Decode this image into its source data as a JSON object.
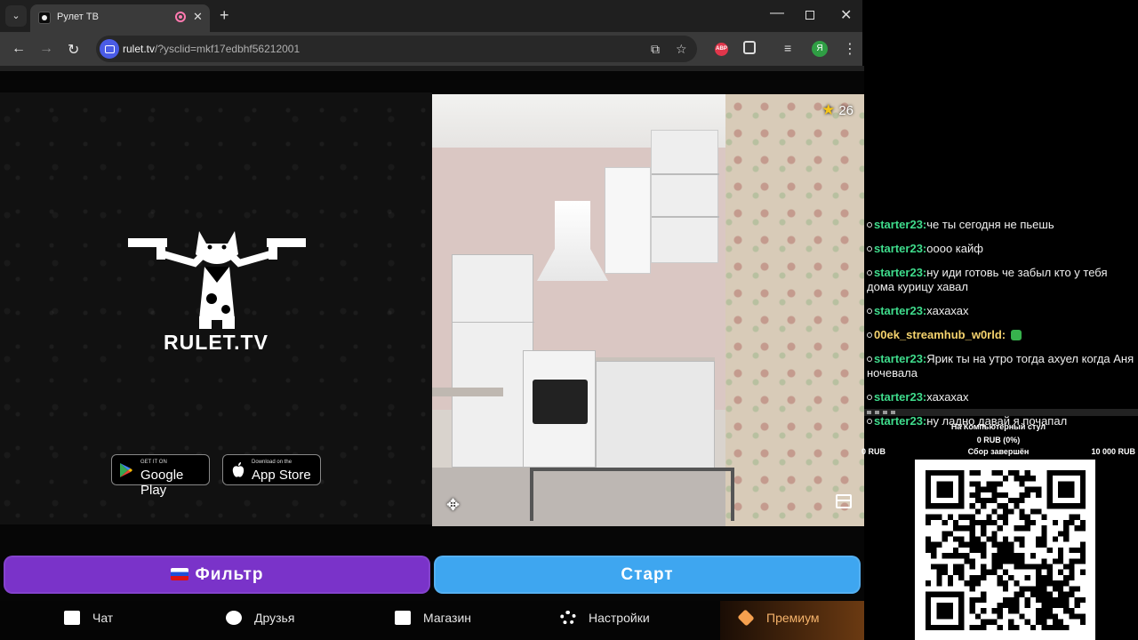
{
  "browser": {
    "tab_title": "Рулет ТВ",
    "tab_close": "✕",
    "new_tab": "+",
    "url_host": "rulet.tv",
    "url_rest": "/?ysclid=mkf17edbhf56212001",
    "back": "←",
    "forward": "→",
    "reload": "↻",
    "menu_chevron": "⌄",
    "window_min": "—",
    "window_close": "✕",
    "install": "⧉",
    "bookmark": "☆",
    "extension_abp": "ABP",
    "media": "≡",
    "profile_initial": "Я",
    "menu": "⋮"
  },
  "left_panel": {
    "logo_text": "RULET.TV",
    "google_play": {
      "small": "GET IT ON",
      "big": "Google Play"
    },
    "app_store": {
      "small": "Download on the",
      "big": "App Store"
    }
  },
  "video": {
    "star_count": "26",
    "star_icon": "★",
    "move_icon": "✥"
  },
  "actions": {
    "filter_label": "Фильтр",
    "start_label": "Старт"
  },
  "bottom_nav": {
    "chat": "Чат",
    "friends": "Друзья",
    "shop": "Магазин",
    "settings": "Настройки",
    "premium": "Премиум"
  },
  "chat": {
    "user_color": "#3fdc8c",
    "alt_user_color": "#f5d36e",
    "messages": [
      {
        "user": "starter23:",
        "text": "че ты сегодня не пьешь"
      },
      {
        "user": "starter23:",
        "text": "оооо кайф"
      },
      {
        "user": "starter23:",
        "text": "ну иди готовь че забыл кто у тебя дома курицу хавал"
      },
      {
        "user": "starter23:",
        "text": "хахахах"
      },
      {
        "user": "00ek_streamhub_w0rld:",
        "text": ""
      },
      {
        "user": "starter23:",
        "text": "Ярик ты на утро тогда ахуел когда Аня ночевала"
      },
      {
        "user": "starter23:",
        "text": "хахахах"
      },
      {
        "user": "starter23:",
        "text": "ну ладно давай я почапал"
      }
    ]
  },
  "donation": {
    "title": "На Компьютерный стул",
    "amount": "0 RUB (0%)",
    "min": "0 RUB",
    "status": "Сбор завершён",
    "max": "10 000 RUB"
  }
}
